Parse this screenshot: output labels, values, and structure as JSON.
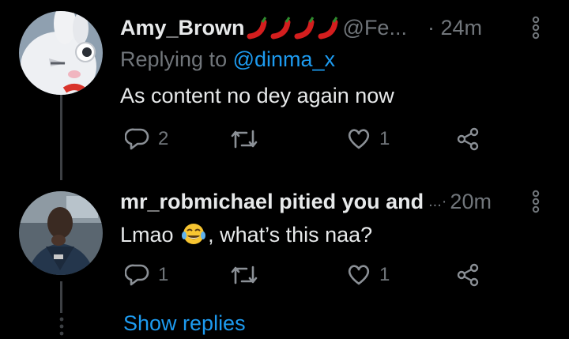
{
  "tweets": [
    {
      "author_name": "Amy_Brown",
      "name_emojis": [
        "chili-pepper",
        "chili-pepper",
        "chili-pepper",
        "chili-pepper"
      ],
      "handle": "@Fe...",
      "time": "· 24m",
      "replying_label": "Replying to ",
      "replying_handle": "@dinma_x",
      "text": "As content no dey again now",
      "reply_count": "2",
      "retweet_count": "",
      "like_count": "1"
    },
    {
      "author_name": "mr_robmichael pitied you and",
      "handle": "...·",
      "time": "20m",
      "text_before": "Lmao",
      "text_emoji": "face-with-tears-of-joy",
      "text_after": ", what’s this naa?",
      "reply_count": "1",
      "retweet_count": "",
      "like_count": "1"
    }
  ],
  "show_replies_label": "Show replies",
  "colors": {
    "background": "#000000",
    "primary_text": "#e7e9ea",
    "secondary_text": "#71767b",
    "accent_link": "#1d9bf0",
    "thread_line": "#3d4044"
  }
}
